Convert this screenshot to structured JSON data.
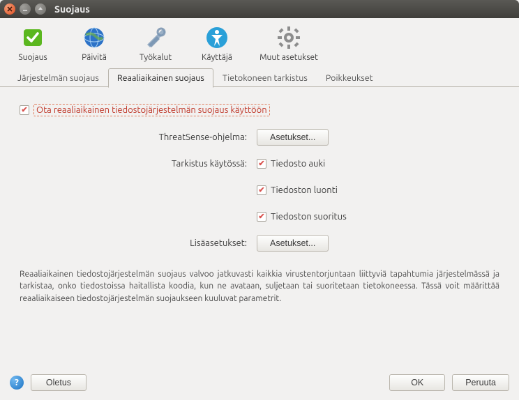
{
  "window": {
    "title": "Suojaus"
  },
  "toolbar": {
    "items": [
      {
        "label": "Suojaus"
      },
      {
        "label": "Päivitä"
      },
      {
        "label": "Työkalut"
      },
      {
        "label": "Käyttäjä"
      },
      {
        "label": "Muut asetukset"
      }
    ]
  },
  "tabs": {
    "items": [
      {
        "label": "Järjestelmän suojaus"
      },
      {
        "label": "Reaaliaikainen suojaus"
      },
      {
        "label": "Tietokoneen tarkistus"
      },
      {
        "label": "Poikkeukset"
      }
    ],
    "active_index": 1
  },
  "panel": {
    "enable_label": "Ota reaaliaikainen tiedostojärjestelmän suojaus käyttöön",
    "enable_checked": true,
    "threatsense_label": "ThreatSense-ohjelma:",
    "threatsense_button": "Asetukset...",
    "scan_label": "Tarkistus käytössä:",
    "scan_options": [
      {
        "label": "Tiedosto auki",
        "checked": true
      },
      {
        "label": "Tiedoston luonti",
        "checked": true
      },
      {
        "label": "Tiedoston suoritus",
        "checked": true
      }
    ],
    "advanced_label": "Lisäasetukset:",
    "advanced_button": "Asetukset...",
    "description": "Reaaliaikainen tiedostojärjestelmän suojaus valvoo jatkuvasti kaikkia virustentorjuntaan liittyviä tapahtumia järjestelmässä ja tarkistaa, onko tiedostoissa haitallista koodia, kun ne avataan, suljetaan tai suoritetaan tietokoneessa. Tässä voit määrittää reaaliaikaiseen tiedostojärjestelmän suojaukseen kuuluvat parametrit."
  },
  "footer": {
    "defaults": "Oletus",
    "ok": "OK",
    "cancel": "Peruuta"
  },
  "colors": {
    "accent_red": "#c0392b",
    "button_bg": "#f0efed"
  }
}
